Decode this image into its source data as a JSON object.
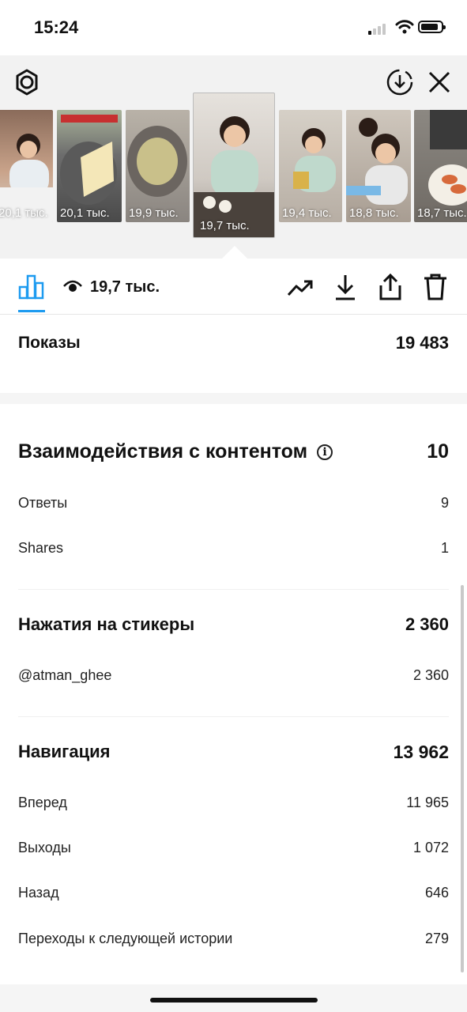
{
  "status_bar": {
    "time": "15:24"
  },
  "thumbnails": [
    {
      "views": "20,1 тыс."
    },
    {
      "views": "20,1 тыс."
    },
    {
      "views": "19,9 тыс."
    },
    {
      "views": "19,7 тыс.",
      "selected": true
    },
    {
      "views": "19,4 тыс."
    },
    {
      "views": "18,8 тыс."
    },
    {
      "views": "18,7 тыс."
    }
  ],
  "toolbar": {
    "views": "19,7 тыс.",
    "icons": [
      "bar-chart-icon",
      "eye-icon",
      "trending-icon",
      "download-icon",
      "share-icon",
      "trash-icon"
    ]
  },
  "stats": {
    "impressions": {
      "label": "Показы",
      "value": "19 483"
    },
    "interactions": {
      "label": "Взаимодействия с контентом",
      "value": "10",
      "rows": [
        {
          "label": "Ответы",
          "value": "9"
        },
        {
          "label": "Shares",
          "value": "1"
        }
      ]
    },
    "sticker_taps": {
      "label": "Нажатия на стикеры",
      "value": "2 360",
      "rows": [
        {
          "label": "@atman_ghee",
          "value": "2 360"
        }
      ]
    },
    "navigation": {
      "label": "Навигация",
      "value": "13 962",
      "rows": [
        {
          "label": "Вперед",
          "value": "11 965"
        },
        {
          "label": "Выходы",
          "value": "1 072"
        },
        {
          "label": "Назад",
          "value": "646"
        },
        {
          "label": "Переходы к следующей истории",
          "value": "279"
        }
      ]
    }
  },
  "colors": {
    "accent": "#1d9bf0",
    "background": "#ffffff",
    "header_bg": "#f2f2f2"
  }
}
